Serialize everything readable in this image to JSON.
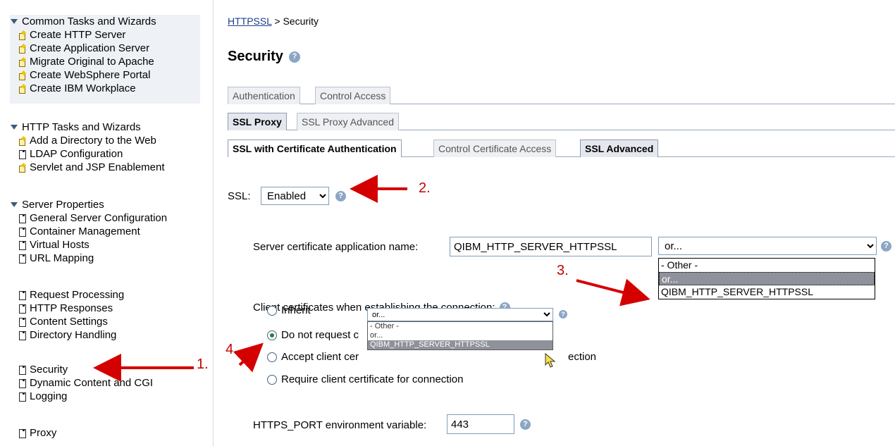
{
  "nav": {
    "common": {
      "title": "Common Tasks and Wizards",
      "items": [
        "Create HTTP Server",
        "Create Application Server",
        "Migrate Original to Apache",
        "Create WebSphere Portal",
        "Create IBM Workplace"
      ]
    },
    "http": {
      "title": "HTTP Tasks and Wizards",
      "items": [
        "Add a Directory to the Web",
        "LDAP Configuration",
        "Servlet and JSP Enablement"
      ]
    },
    "server": {
      "title": "Server Properties",
      "group1": [
        "General Server Configuration",
        "Container Management",
        "Virtual Hosts",
        "URL Mapping"
      ],
      "group2": [
        "Request Processing",
        "HTTP Responses",
        "Content Settings",
        "Directory Handling"
      ],
      "group3": [
        "Security",
        "Dynamic Content and CGI",
        "Logging"
      ],
      "group4": [
        "Proxy"
      ]
    }
  },
  "breadcrumb": {
    "link": "HTTPSSL",
    "separator": " > ",
    "current": "Security"
  },
  "page_title": "Security",
  "tabs": {
    "row1": [
      "Authentication",
      "Control Access"
    ],
    "row2": [
      "SSL Proxy",
      "SSL Proxy Advanced"
    ],
    "row3": [
      "SSL with Certificate Authentication",
      "Control Certificate Access",
      "SSL Advanced"
    ]
  },
  "ssl": {
    "label": "SSL:",
    "value": "Enabled"
  },
  "cert": {
    "label": "Server certificate application name:",
    "value": "QIBM_HTTP_SERVER_HTTPSSL",
    "select_value": "or...",
    "options": [
      "- Other -",
      "or...",
      "QIBM_HTTP_SERVER_HTTPSSL"
    ]
  },
  "client": {
    "label": "Client certificates when establishing the connection:",
    "radios": [
      {
        "label": "Inherit",
        "checked": false
      },
      {
        "label": "Do not request c",
        "checked": true
      },
      {
        "label": "Accept client cer",
        "tail": "ection",
        "checked": false
      },
      {
        "label": "Require client certificate for connection",
        "checked": false
      }
    ],
    "mini_select_value": "or...",
    "mini_options": [
      "- Other -",
      "or...",
      "QIBM_HTTP_SERVER_HTTPSSL"
    ]
  },
  "https_port": {
    "label": "HTTPS_PORT environment variable:",
    "value": "443"
  },
  "annotations": [
    "1.",
    "2.",
    "3.",
    "4."
  ],
  "colors": {
    "annotation": "#c40000",
    "link": "#1a3f8c",
    "help": "#8ca6c4"
  }
}
